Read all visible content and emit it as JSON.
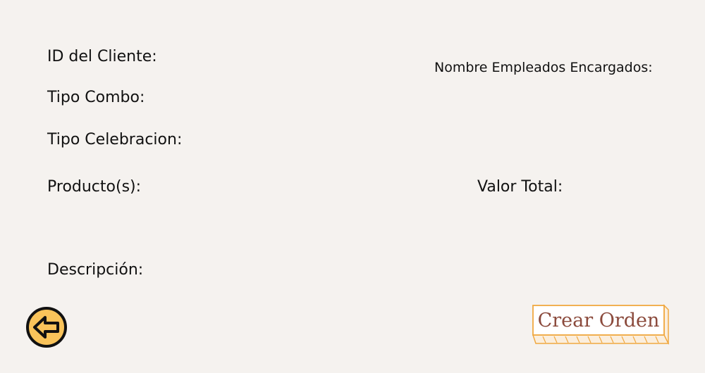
{
  "form": {
    "cliente_label": "ID del Cliente:",
    "combo_label": "Tipo Combo:",
    "celebracion_label": "Tipo Celebracion:",
    "producto_label": "Producto(s):",
    "descripcion_label": "Descripción:",
    "empleados_label": "Nombre Empleados Encargados:",
    "total_label": "Valor Total:"
  },
  "actions": {
    "create_label": "Crear Orden",
    "back_icon": "arrow-left-icon"
  },
  "colors": {
    "background": "#f5f2ef",
    "text": "#111111",
    "back_button_fill": "#f9c35a",
    "create_button_border": "#f0a840",
    "create_button_text": "#8b4a3c"
  }
}
